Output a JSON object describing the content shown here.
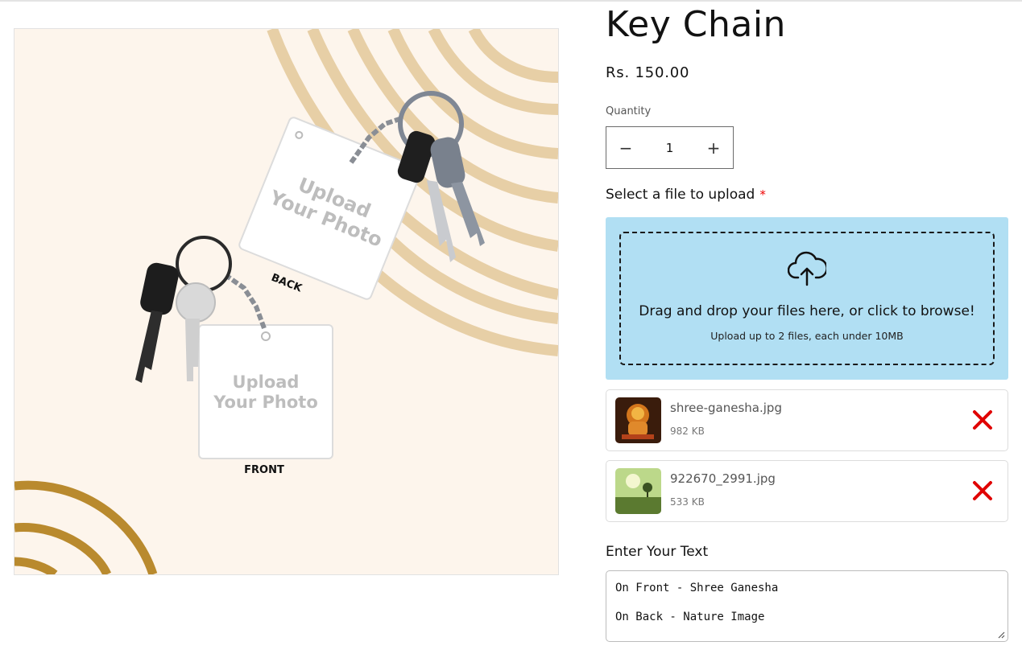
{
  "product": {
    "title": "Key Chain",
    "price": "Rs. 150.00"
  },
  "media": {
    "back_card_text_1": "Upload",
    "back_card_text_2": "Your Photo",
    "back_label": "BACK",
    "front_card_text_1": "Upload",
    "front_card_text_2": "Your Photo",
    "front_label": "FRONT"
  },
  "quantity": {
    "label": "Quantity",
    "value": "1",
    "decrease_symbol": "−",
    "increase_symbol": "+"
  },
  "upload": {
    "label": "Select a file to upload",
    "required_mark": "*",
    "drop_text": "Drag and drop your files here, or click to browse!",
    "limit_text": "Upload up to 2 files, each under 10MB",
    "icon": "cloud-upload-icon"
  },
  "files": [
    {
      "name": "shree-ganesha.jpg",
      "size": "982 KB"
    },
    {
      "name": "922670_2991.jpg",
      "size": "533 KB"
    }
  ],
  "custom_text": {
    "label": "Enter Your Text",
    "line1": "On Front - Shree Ganesha",
    "line2": "On Back - Nature Image"
  },
  "colors": {
    "dropzone_bg": "#b1dff3",
    "remove_icon": "#e00000",
    "required": "#e00000"
  }
}
